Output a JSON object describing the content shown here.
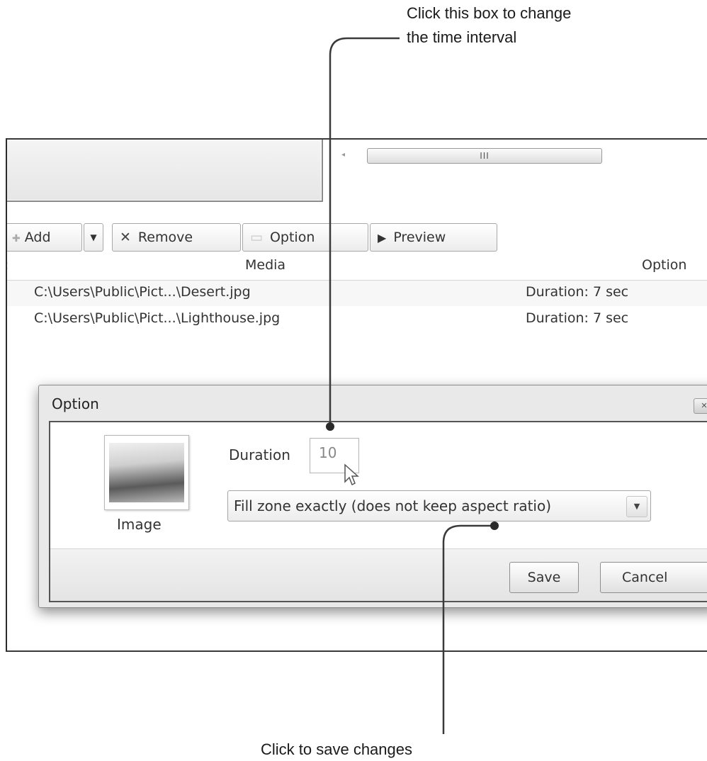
{
  "callouts": {
    "top_line1": "Click this box to change",
    "top_line2": "the time interval",
    "bottom": "Click to save changes"
  },
  "scrollbar": {
    "thumb_grip": "III"
  },
  "toolbar": {
    "add_label": "Add",
    "add_icon": "plus-icon",
    "remove_label": "Remove",
    "remove_icon": "x-icon",
    "option_label": "Option",
    "option_icon": "document-icon",
    "preview_label": "Preview",
    "preview_icon": "play-icon"
  },
  "list": {
    "headers": {
      "media": "Media",
      "option": "Option"
    },
    "rows": [
      {
        "path": "C:\\Users\\Public\\Pict...\\Desert.jpg",
        "option": "Duration: 7 sec"
      },
      {
        "path": "C:\\Users\\Public\\Pict...\\Lighthouse.jpg",
        "option": "Duration: 7 sec"
      }
    ]
  },
  "dialog": {
    "title": "Option",
    "image_label": "Image",
    "duration_label": "Duration",
    "duration_value": "10",
    "fill_mode": "Fill zone exactly (does not keep aspect ratio)",
    "save_label": "Save",
    "cancel_label": "Cancel"
  },
  "colors": {
    "callout_line": "#3a3a3a",
    "dialog_border": "#555555"
  }
}
